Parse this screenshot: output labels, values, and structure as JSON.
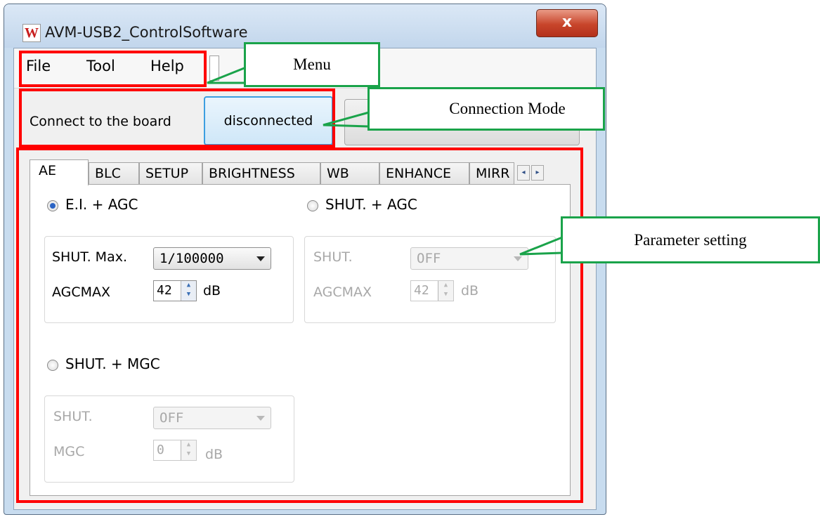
{
  "window": {
    "title": "AVM-USB2_ControlSoftware",
    "app_icon_glyph": "W",
    "close_glyph": "x"
  },
  "menu": {
    "items": [
      "File",
      "Tool",
      "Help"
    ]
  },
  "connection": {
    "label": "Connect to the board",
    "button_label": "disconnected"
  },
  "tabs": {
    "items": [
      "AE",
      "BLC",
      "SETUP",
      "BRIGHTNESS",
      "WB",
      "ENHANCE",
      "MIRR"
    ],
    "active": "AE",
    "scroll_left": "◂",
    "scroll_right": "▸"
  },
  "ae": {
    "ei_agc": {
      "label": "E.I. + AGC",
      "selected": true,
      "shut_max_label": "SHUT. Max.",
      "shut_max_value": "1/100000",
      "agcmax_label": "AGCMAX",
      "agcmax_value": "42",
      "agcmax_unit": "dB"
    },
    "shut_agc": {
      "label": "SHUT. + AGC",
      "selected": false,
      "shut_label": "SHUT.",
      "shut_value": "OFF",
      "agcmax_label": "AGCMAX",
      "agcmax_value": "42",
      "agcmax_unit": "dB"
    },
    "shut_mgc": {
      "label": "SHUT. + MGC",
      "selected": false,
      "shut_label": "SHUT.",
      "shut_value": "OFF",
      "mgc_label": "MGC",
      "mgc_value": "0",
      "mgc_unit": "dB"
    }
  },
  "annotations": {
    "menu": "Menu",
    "connection_mode": "Connection Mode",
    "parameter_setting": "Parameter setting",
    "highlight_color": "#ff0000",
    "callout_color": "#1aa34a"
  }
}
